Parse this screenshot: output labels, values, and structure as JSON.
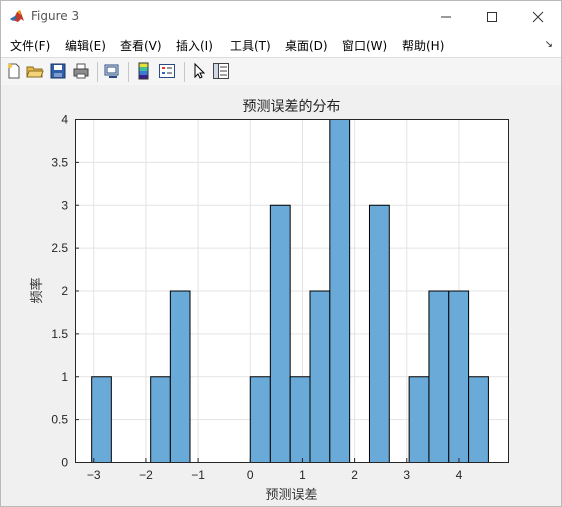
{
  "window": {
    "title": "Figure 3",
    "minimize_icon": "minimize-icon",
    "maximize_icon": "maximize-icon",
    "close_icon": "close-icon"
  },
  "menu": {
    "items": [
      "文件(F)",
      "编辑(E)",
      "查看(V)",
      "插入(I)",
      "工具(T)",
      "桌面(D)",
      "窗口(W)",
      "帮助(H)"
    ],
    "overflow_icon": "dock-arrow-icon"
  },
  "toolbar": {
    "buttons": [
      "new-figure-icon",
      "open-file-icon",
      "save-icon",
      "print-icon",
      "link-icon",
      "colorbar-icon",
      "legend-icon",
      "pointer-icon",
      "property-inspector-icon"
    ]
  },
  "chart_data": {
    "type": "bar",
    "title": "预测误差的分布",
    "xlabel": "预测误差",
    "ylabel": "频率",
    "xlim": [
      -3.35,
      4.95
    ],
    "ylim": [
      0,
      4
    ],
    "xticks": [
      "-3",
      "-2",
      "-1",
      "0",
      "1",
      "2",
      "3",
      "4"
    ],
    "yticks": [
      "0",
      "0.5",
      "1",
      "1.5",
      "2",
      "2.5",
      "3",
      "3.5",
      "4"
    ],
    "bin_width": 0.377,
    "bin_edges_start": -3.04,
    "bins": [
      {
        "x0": -3.04,
        "x1": -2.663,
        "count": 1
      },
      {
        "x0": -1.909,
        "x1": -1.532,
        "count": 1
      },
      {
        "x0": -1.532,
        "x1": -1.155,
        "count": 2
      },
      {
        "x0": 0.0,
        "x1": 0.385,
        "count": 1
      },
      {
        "x0": 0.385,
        "x1": 0.765,
        "count": 3
      },
      {
        "x0": 0.765,
        "x1": 1.145,
        "count": 1
      },
      {
        "x0": 1.145,
        "x1": 1.525,
        "count": 2
      },
      {
        "x0": 1.525,
        "x1": 1.905,
        "count": 4
      },
      {
        "x0": 2.285,
        "x1": 2.665,
        "count": 3
      },
      {
        "x0": 3.045,
        "x1": 3.425,
        "count": 1
      },
      {
        "x0": 3.425,
        "x1": 3.805,
        "count": 2
      },
      {
        "x0": 3.805,
        "x1": 4.185,
        "count": 2
      },
      {
        "x0": 4.185,
        "x1": 4.565,
        "count": 1
      }
    ],
    "bar_color": "#6aaad8",
    "edge_color": "#000000",
    "grid": true
  }
}
